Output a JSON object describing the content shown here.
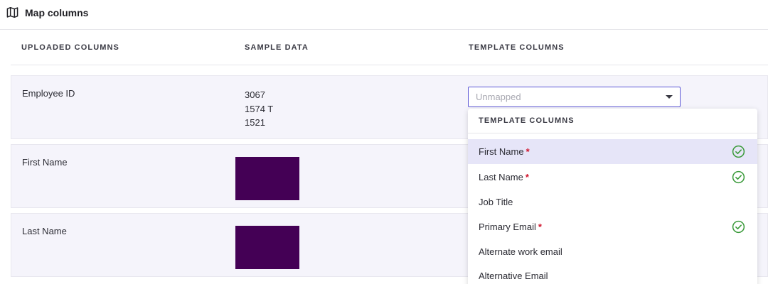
{
  "header": {
    "title": "Map columns",
    "icon": "map-icon"
  },
  "columns": {
    "uploaded": "UPLOADED COLUMNS",
    "sample": "SAMPLE DATA",
    "template": "TEMPLATE COLUMNS"
  },
  "rows": [
    {
      "label": "Employee ID",
      "samples": [
        "3067",
        "1574 T",
        "1521"
      ]
    },
    {
      "label": "First Name",
      "samples_redacted": true
    },
    {
      "label": "Last Name",
      "samples_redacted": true
    }
  ],
  "select": {
    "placeholder": "Unmapped"
  },
  "dropdown": {
    "header": "TEMPLATE COLUMNS",
    "options": [
      {
        "label": "First Name",
        "required": true,
        "mapped": true,
        "highlighted": true
      },
      {
        "label": "Last Name",
        "required": true,
        "mapped": true
      },
      {
        "label": "Job Title",
        "required": false,
        "mapped": false
      },
      {
        "label": "Primary Email",
        "required": true,
        "mapped": true
      },
      {
        "label": "Alternate work email",
        "required": false,
        "mapped": false
      },
      {
        "label": "Alternative Email",
        "required": false,
        "mapped": false
      }
    ],
    "required_marker": "*"
  },
  "colors": {
    "accent": "#5b56d6",
    "required": "#d0142c",
    "check": "#3a9a3a",
    "redaction": "#440055",
    "highlight": "#e6e5f8"
  }
}
